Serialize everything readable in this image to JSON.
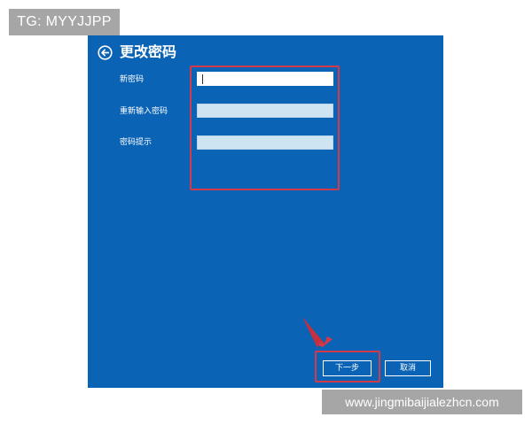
{
  "watermark": {
    "tg_text": "TG: MYYJJPP",
    "url_text": "www.jingmibaijialezhcn.com"
  },
  "dialog": {
    "title": "更改密码",
    "back_icon": "arrow-left-circle-icon",
    "fields": [
      {
        "label": "新密码",
        "value": "",
        "state": "focused"
      },
      {
        "label": "重新输入密码",
        "value": ""
      },
      {
        "label": "密码提示",
        "value": ""
      }
    ],
    "buttons": {
      "next_label": "下一步",
      "cancel_label": "取消"
    }
  },
  "colors": {
    "panel_background": "#0a63b4",
    "highlight_red": "#d23a49",
    "watermark_gray": "#a6a6a6"
  }
}
